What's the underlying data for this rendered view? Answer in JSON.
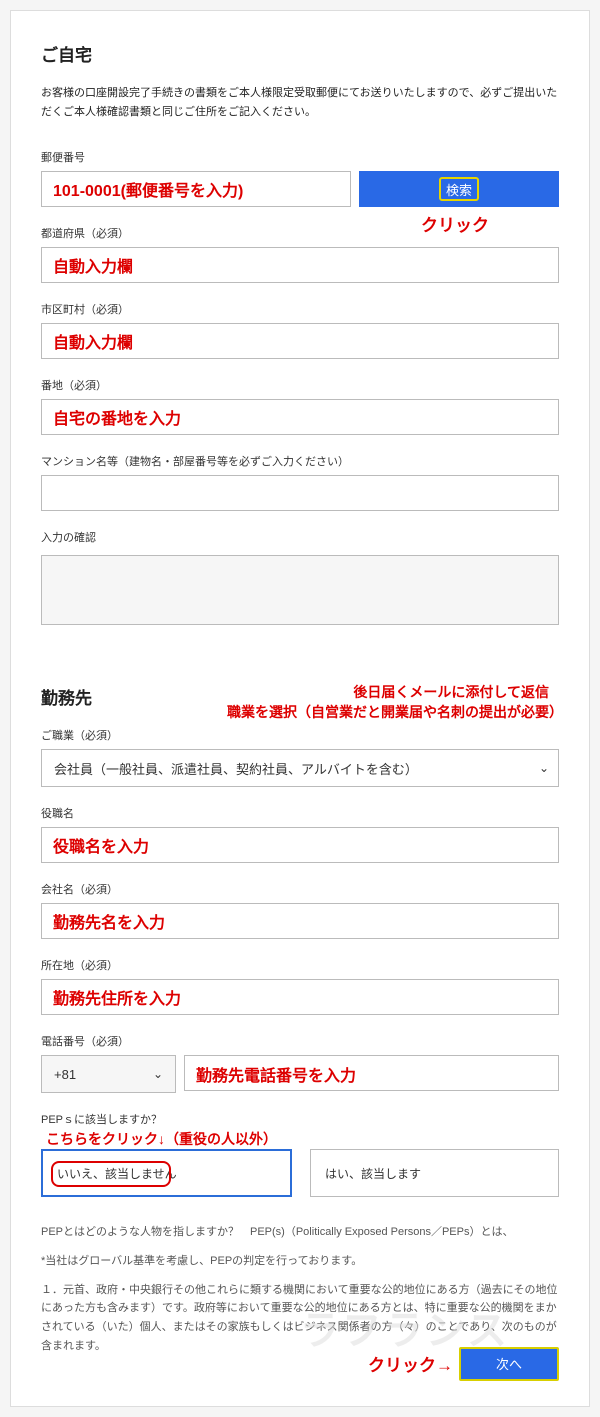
{
  "home": {
    "title": "ご自宅",
    "intro": "お客様の口座開設完了手続きの書類をご本人様限定受取郵便にてお送りいたしますので、必ずご提出いただくご本人様確認書類と同じご住所をご記入ください。",
    "postal": {
      "label": "郵便番号",
      "search_label": "検索",
      "annot_value": "101-0001(郵便番号を入力)",
      "annot_click": "クリック"
    },
    "pref": {
      "label": "都道府県（必須）",
      "annot": "自動入力欄"
    },
    "city": {
      "label": "市区町村（必須）",
      "annot": "自動入力欄"
    },
    "street": {
      "label": "番地（必須）",
      "annot": "自宅の番地を入力"
    },
    "building": {
      "label": "マンション名等（建物名・部屋番号等を必ずご入力ください）"
    },
    "confirm": {
      "label": "入力の確認"
    }
  },
  "work": {
    "title": "勤務先",
    "annot_top1": "後日届くメールに添付して返信",
    "annot_top2": "職業を選択（自営業だと開業届や名刺の提出が必要）",
    "occupation": {
      "label": "ご職業（必須）",
      "selected": "会社員（一般社員、派遣社員、契約社員、アルバイトを含む）"
    },
    "position": {
      "label": "役職名",
      "annot": "役職名を入力"
    },
    "company": {
      "label": "会社名（必須）",
      "annot": "勤務先名を入力"
    },
    "location": {
      "label": "所在地（必須）",
      "annot": "勤務先住所を入力"
    },
    "phone": {
      "label": "電話番号（必須）",
      "code": "+81",
      "annot": "勤務先電話番号を入力"
    }
  },
  "pep": {
    "question": "PEPｓに該当しますか？",
    "annot_click": "こちらをクリック↓（重役の人以外）",
    "no": "いいえ、該当しません",
    "yes": "はい、該当します",
    "desc1": "PEPとはどのような人物を指しますか？　PEP(s)（Politically Exposed Persons／PEPs）とは、",
    "desc2": "*当社はグローバル基準を考慮し、PEPの判定を行っております。",
    "desc3": "１．元首、政府・中央銀行その他これらに類する機関において重要な公的地位にある方（過去にその地位にあった方も含みます）です。政府等において重要な公的地位にある方とは、特に重要な公的機関をまかされている（いた）個人、またはその家族もしくはビジネス関係者の方（々）のことであり、次のものが含まれます。"
  },
  "footer": {
    "annot_click": "クリック→",
    "next": "次へ"
  },
  "watermark": "ラフランス"
}
